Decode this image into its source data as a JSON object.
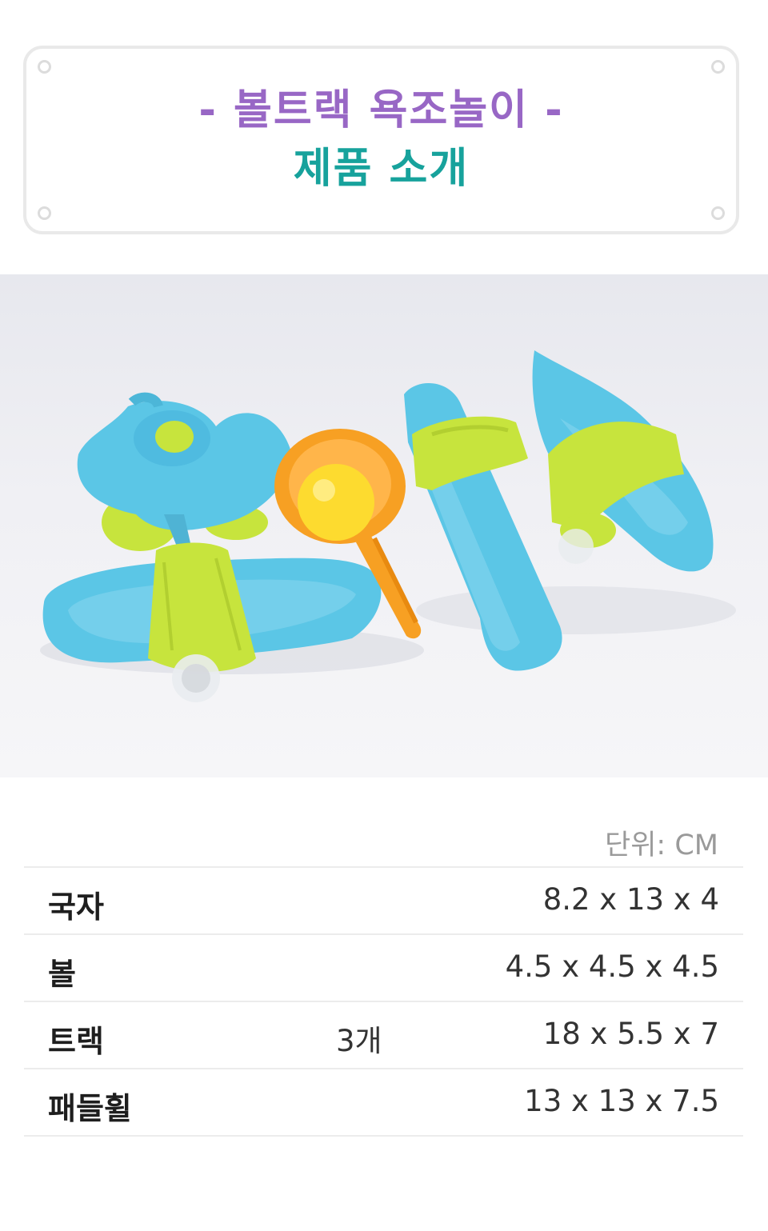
{
  "header": {
    "title_line1": "- 볼트랙 욕조놀이 -",
    "title_line2": "제품 소개"
  },
  "photo": {
    "items": [
      "paddle-wheel",
      "water-scoop",
      "ball",
      "track",
      "track",
      "track"
    ]
  },
  "specs": {
    "unit_label": "단위: CM",
    "rows": [
      {
        "name": "국자",
        "qty": "",
        "size": "8.2 x 13 x 4"
      },
      {
        "name": "볼",
        "qty": "",
        "size": "4.5 x 4.5 x 4.5"
      },
      {
        "name": "트랙",
        "qty": "3개",
        "size": "18 x 5.5 x 7"
      },
      {
        "name": "패들휠",
        "qty": "",
        "size": "13 x 13 x 7.5"
      }
    ]
  },
  "colors": {
    "title_purple": "#9867c5",
    "title_teal": "#17a29c",
    "toy_blue": "#5bc6e6",
    "toy_lime": "#c7e43d",
    "toy_orange": "#f7a023",
    "ball_yellow": "#fddb2f"
  }
}
